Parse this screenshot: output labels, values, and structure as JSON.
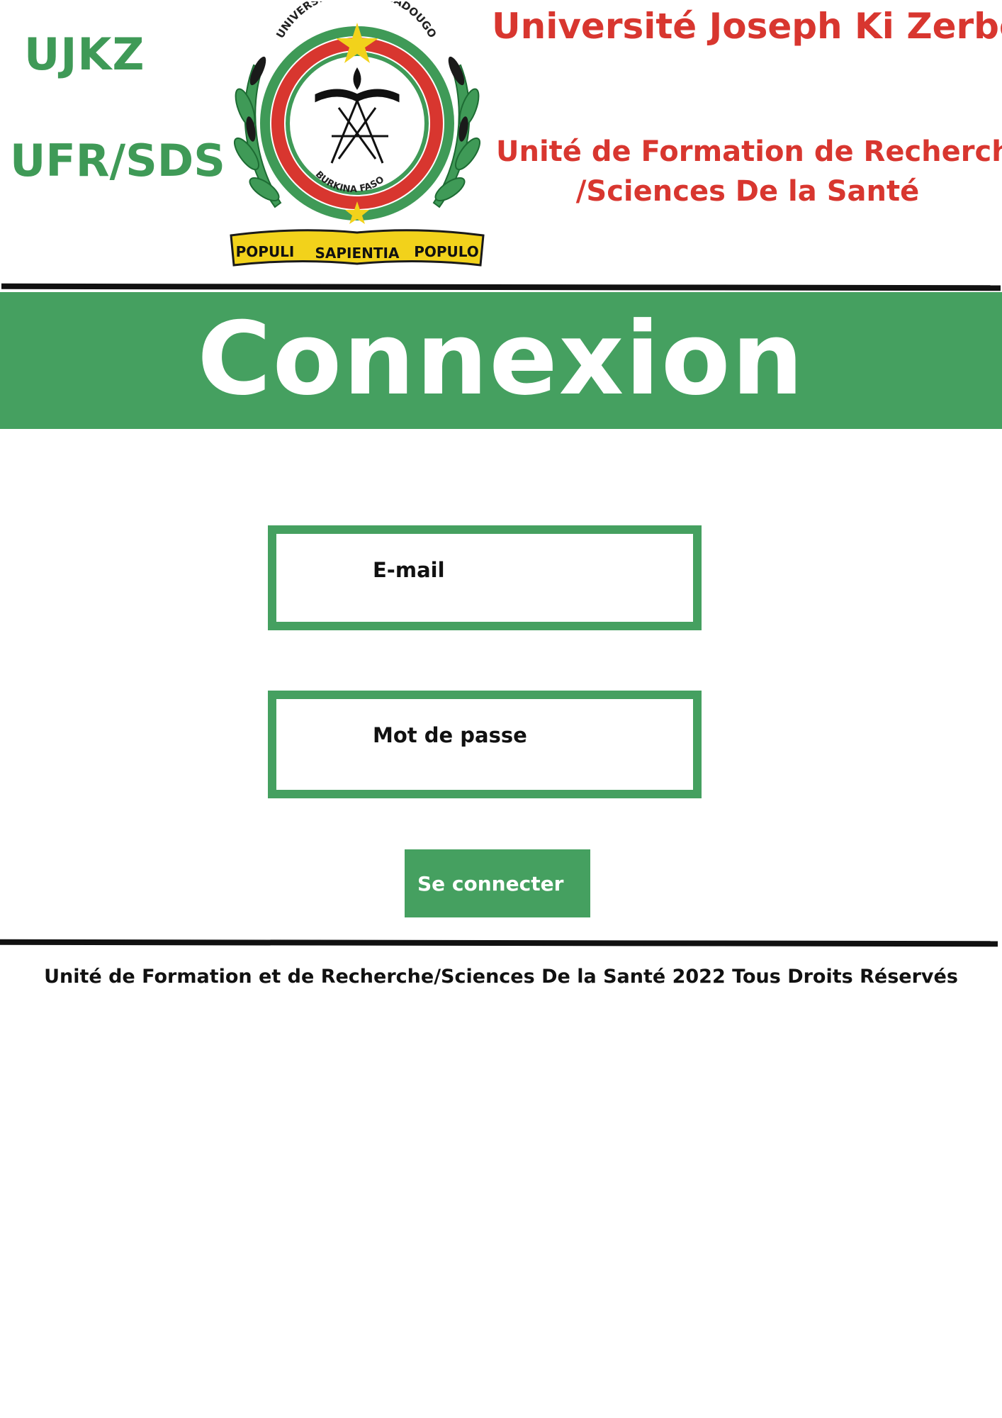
{
  "header": {
    "short_name": "UJKZ",
    "faculty_code": "UFR/SDS",
    "university_name": "Université Joseph Ki Zerbo",
    "faculty_name_line1": "Unité de Formation  de Recherche",
    "faculty_name_line2": "/Sciences  De la Santé"
  },
  "emblem": {
    "ring_text": "UNIVERSITE DE OUAGADOUGOU",
    "inner_text": "BURKINA FASO",
    "ribbon": [
      "POPULI",
      "SAPIENTIA",
      "POPULO"
    ],
    "colors": {
      "red": "#d8362f",
      "green": "#3f9a57",
      "yellow": "#f2d21b"
    }
  },
  "banner": {
    "title": "Connexion",
    "color": "#45a060"
  },
  "form": {
    "email_label": "E-mail",
    "password_label": "Mot de passe",
    "submit_label": "Se connecter"
  },
  "footer": {
    "text": "Unité de Formation et de Recherche/Sciences De la Santé 2022 Tous Droits Réservés"
  }
}
